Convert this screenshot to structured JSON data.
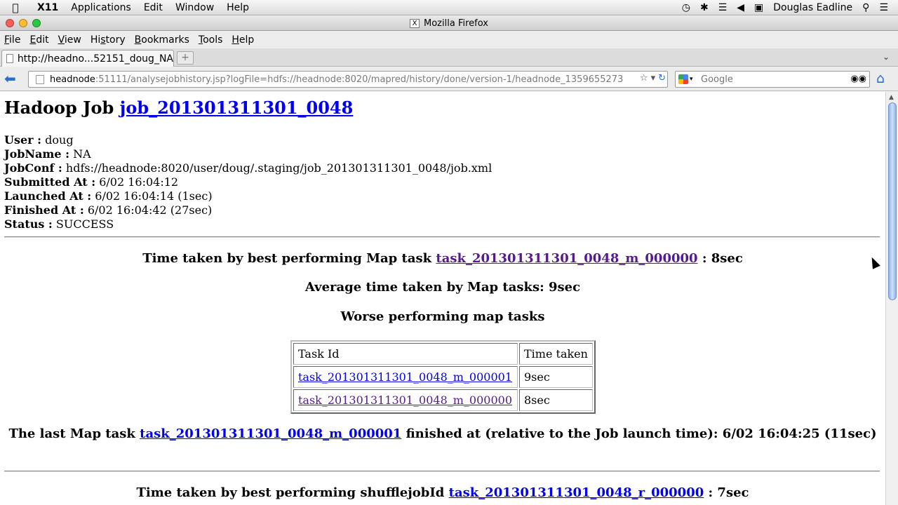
{
  "macbar": {
    "app": "X11",
    "menus": [
      "Applications",
      "Edit",
      "Window",
      "Help"
    ],
    "user": "Douglas Eadline",
    "icons": [
      "apple-icon",
      "time-machine-icon",
      "bluetooth-icon",
      "wifi-icon",
      "volume-icon",
      "battery-icon",
      "spotlight-icon",
      "notification-icon"
    ]
  },
  "window": {
    "title": "Mozilla Firefox",
    "x_logo": "X"
  },
  "ffmenu": {
    "items": [
      {
        "ul": "F",
        "rest": "ile"
      },
      {
        "ul": "E",
        "rest": "dit"
      },
      {
        "ul": "V",
        "rest": "iew"
      },
      {
        "pre": "Hi",
        "ul": "s",
        "rest": "tory"
      },
      {
        "ul": "B",
        "rest": "ookmarks"
      },
      {
        "ul": "T",
        "rest": "ools"
      },
      {
        "ul": "H",
        "rest": "elp"
      }
    ]
  },
  "tab": {
    "label": "http://headno...52151_doug_NA",
    "newtab": "+",
    "list_icon": "⌄"
  },
  "nav": {
    "url_host": "headnode",
    "url_rest": ":51111/analysejobhistory.jsp?logFile=hdfs://headnode:8020/mapred/history/done/version-1/headnode_1359655273",
    "search_placeholder": "Google"
  },
  "page": {
    "heading_prefix": "Hadoop Job",
    "job_id": "job_201301311301_0048",
    "info": [
      {
        "label": "User :",
        "value": " doug"
      },
      {
        "label": "JobName :",
        "value": " NA"
      },
      {
        "label": "JobConf :",
        "value": " hdfs://headnode:8020/user/doug/.staging/job_201301311301_0048/job.xml"
      },
      {
        "label": "Submitted At :",
        "value": " 6/02 16:04:12"
      },
      {
        "label": "Launched At :",
        "value": " 6/02 16:04:14 (1sec)"
      },
      {
        "label": "Finished At :",
        "value": " 6/02 16:04:42 (27sec)"
      },
      {
        "label": "Status :",
        "value": " SUCCESS"
      }
    ],
    "best_map": {
      "prefix": "Time taken by best performing Map task ",
      "task": "task_201301311301_0048_m_000000",
      "suffix": " : 8sec"
    },
    "avg_map": "Average time taken by Map tasks: 9sec",
    "worse_title": "Worse performing map tasks",
    "worse_table": {
      "headers": [
        "Task Id",
        "Time taken"
      ],
      "rows": [
        {
          "task": "task_201301311301_0048_m_000001",
          "time": "9sec"
        },
        {
          "task": "task_201301311301_0048_m_000000",
          "time": "8sec"
        }
      ]
    },
    "last_map": {
      "prefix": "The last Map task ",
      "task": "task_201301311301_0048_m_000001",
      "suffix": " finished at (relative to the Job launch time): 6/02 16:04:25 (11sec)"
    },
    "best_shuffle": {
      "prefix": "Time taken by best performing shufflejobId ",
      "task": "task_201301311301_0048_r_000000",
      "suffix": " : 7sec"
    }
  }
}
